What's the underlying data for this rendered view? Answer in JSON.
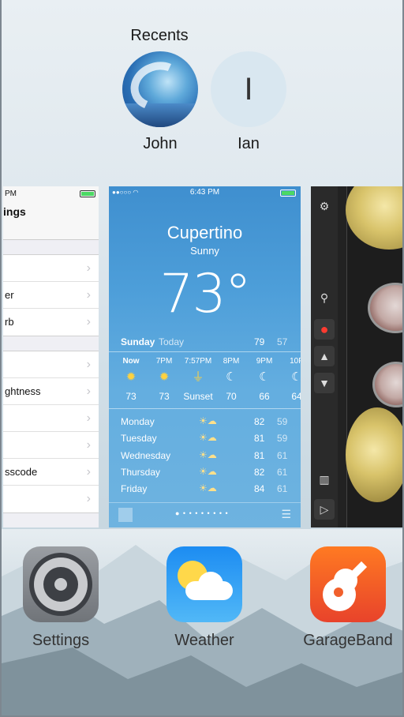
{
  "recents": {
    "title": "Recents",
    "contacts": [
      {
        "name": "John",
        "initial": ""
      },
      {
        "name": "Ian",
        "initial": "I"
      }
    ]
  },
  "settings_card": {
    "time": "PM",
    "title": "ings",
    "rows_group1": [
      "",
      "er",
      "rb"
    ],
    "rows_group2": [
      "",
      "ghtness",
      "",
      "",
      "sscode",
      ""
    ]
  },
  "weather_card": {
    "time": "6:43 PM",
    "city": "Cupertino",
    "condition": "Sunny",
    "temp": "73°",
    "today": {
      "day": "Sunday",
      "label": "Today",
      "hi": "79",
      "lo": "57"
    },
    "hours": [
      {
        "label": "Now",
        "icon": "sun-icon",
        "value": "73"
      },
      {
        "label": "7PM",
        "icon": "sun-icon",
        "value": "73"
      },
      {
        "label": "7:57PM",
        "icon": "sunset-icon",
        "value": "Sunset"
      },
      {
        "label": "8PM",
        "icon": "moon-icon",
        "value": "70"
      },
      {
        "label": "9PM",
        "icon": "moon-icon",
        "value": "66"
      },
      {
        "label": "10P",
        "icon": "moon-icon",
        "value": "64"
      }
    ],
    "days": [
      {
        "day": "Monday",
        "hi": "82",
        "lo": "59"
      },
      {
        "day": "Tuesday",
        "hi": "81",
        "lo": "59"
      },
      {
        "day": "Wednesday",
        "hi": "81",
        "lo": "61"
      },
      {
        "day": "Thursday",
        "hi": "82",
        "lo": "61"
      },
      {
        "day": "Friday",
        "hi": "84",
        "lo": "61"
      }
    ],
    "pager": "● • • • • • • • •"
  },
  "apps": [
    {
      "name": "Settings",
      "icon": "settings-icon"
    },
    {
      "name": "Weather",
      "icon": "weather-icon"
    },
    {
      "name": "GarageBand",
      "icon": "garageband-icon"
    }
  ]
}
